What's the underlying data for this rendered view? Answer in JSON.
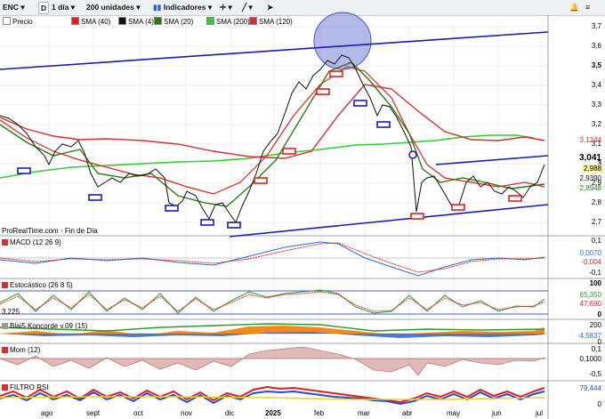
{
  "toolbar": {
    "symbol": "ENC",
    "interval": "1 día",
    "units": "200 unidades",
    "indicators": "Indicadores",
    "symbol_icon": "D"
  },
  "legend": [
    {
      "label": "Precio",
      "color": "#ffffff"
    },
    {
      "label": "SMA (40)",
      "color": "#e02020"
    },
    {
      "label": "SMA (4)",
      "color": "#111111"
    },
    {
      "label": "SMA (20)",
      "color": "#2a7a12"
    },
    {
      "label": "SMA (200)",
      "color": "#33cc33"
    },
    {
      "label": "SMA (120)",
      "color": "#d43030"
    }
  ],
  "source": "ProRealTime.com - Fin de Día",
  "price_axis": [
    "3,7",
    "3,6",
    "3,5",
    "3,4",
    "3,3",
    "3,2",
    "3,1",
    "3",
    "2,9",
    "2,8",
    "2,7"
  ],
  "price_tags": {
    "sma120": "3,1244",
    "price": "3,041",
    "last": "2,988",
    "sma20": "2,9390",
    "sma40": "2,8948"
  },
  "panels": {
    "macd": {
      "title": "MACD (12 26 9)",
      "ticks": [
        "0,1",
        "0,0070",
        "-0,004",
        "-0,1"
      ]
    },
    "stoch": {
      "title": "Estocástico (26 8 5)",
      "ticks": [
        "100",
        "65,350",
        "47,690",
        "0"
      ],
      "left_value": "3,225"
    },
    "koncorde": {
      "title": "Blai5 Koncorde v.09 (15)",
      "ticks": [
        "200",
        "-4,5837",
        "0"
      ]
    },
    "mom": {
      "title": "Mom (12)",
      "ticks": [
        "0,1",
        "0,1000",
        "-0,5"
      ]
    },
    "rsi": {
      "title": "FILTRO RSI",
      "ticks": [
        "79,444",
        "0"
      ]
    }
  },
  "x_axis": [
    "ago",
    "sept",
    "oct",
    "nov",
    "dic",
    "2025",
    "feb",
    "mar",
    "abr",
    "may",
    "jun",
    "jul"
  ],
  "colors": {
    "channel": "#1a1ab8",
    "sma120": "#d43030",
    "sma200": "#33cc33",
    "sma20": "#2a7a12",
    "highlight": "#9aa2e0"
  }
}
